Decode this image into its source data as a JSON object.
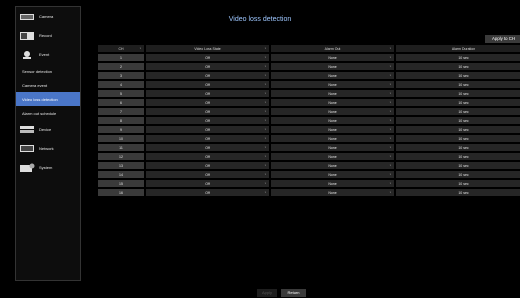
{
  "sidebar": {
    "items": [
      {
        "label": "Camera",
        "icon": "camera-icon"
      },
      {
        "label": "Record",
        "icon": "record-icon"
      },
      {
        "label": "Event",
        "icon": "event-icon"
      },
      {
        "label": "Sensor detection"
      },
      {
        "label": "Camera event"
      },
      {
        "label": "Video loss detection"
      },
      {
        "label": "Alarm out schedule"
      },
      {
        "label": "Device",
        "icon": "device-icon"
      },
      {
        "label": "Network",
        "icon": "network-icon"
      },
      {
        "label": "System",
        "icon": "system-icon"
      }
    ],
    "active_index": 5
  },
  "page": {
    "title": "Video loss detection",
    "apply_to_ch_label": "Apply to CH"
  },
  "table": {
    "headers": [
      "CH",
      "Video Loss State",
      "Alarm Out",
      "Alarm Duration"
    ],
    "rows": [
      [
        "1",
        "Off",
        "None",
        "10 sec"
      ],
      [
        "2",
        "Off",
        "None",
        "10 sec"
      ],
      [
        "3",
        "Off",
        "None",
        "10 sec"
      ],
      [
        "4",
        "Off",
        "None",
        "10 sec"
      ],
      [
        "5",
        "Off",
        "None",
        "10 sec"
      ],
      [
        "6",
        "Off",
        "None",
        "10 sec"
      ],
      [
        "7",
        "Off",
        "None",
        "10 sec"
      ],
      [
        "8",
        "Off",
        "None",
        "10 sec"
      ],
      [
        "9",
        "Off",
        "None",
        "10 sec"
      ],
      [
        "10",
        "Off",
        "None",
        "10 sec"
      ],
      [
        "11",
        "Off",
        "None",
        "10 sec"
      ],
      [
        "12",
        "Off",
        "None",
        "10 sec"
      ],
      [
        "13",
        "Off",
        "None",
        "10 sec"
      ],
      [
        "14",
        "Off",
        "None",
        "10 sec"
      ],
      [
        "15",
        "Off",
        "None",
        "10 sec"
      ],
      [
        "16",
        "Off",
        "None",
        "10 sec"
      ]
    ]
  },
  "footer": {
    "apply_label": "Apply",
    "return_label": "Return"
  },
  "colors": {
    "accent": "#4a76c8",
    "title": "#9ec7ff"
  }
}
